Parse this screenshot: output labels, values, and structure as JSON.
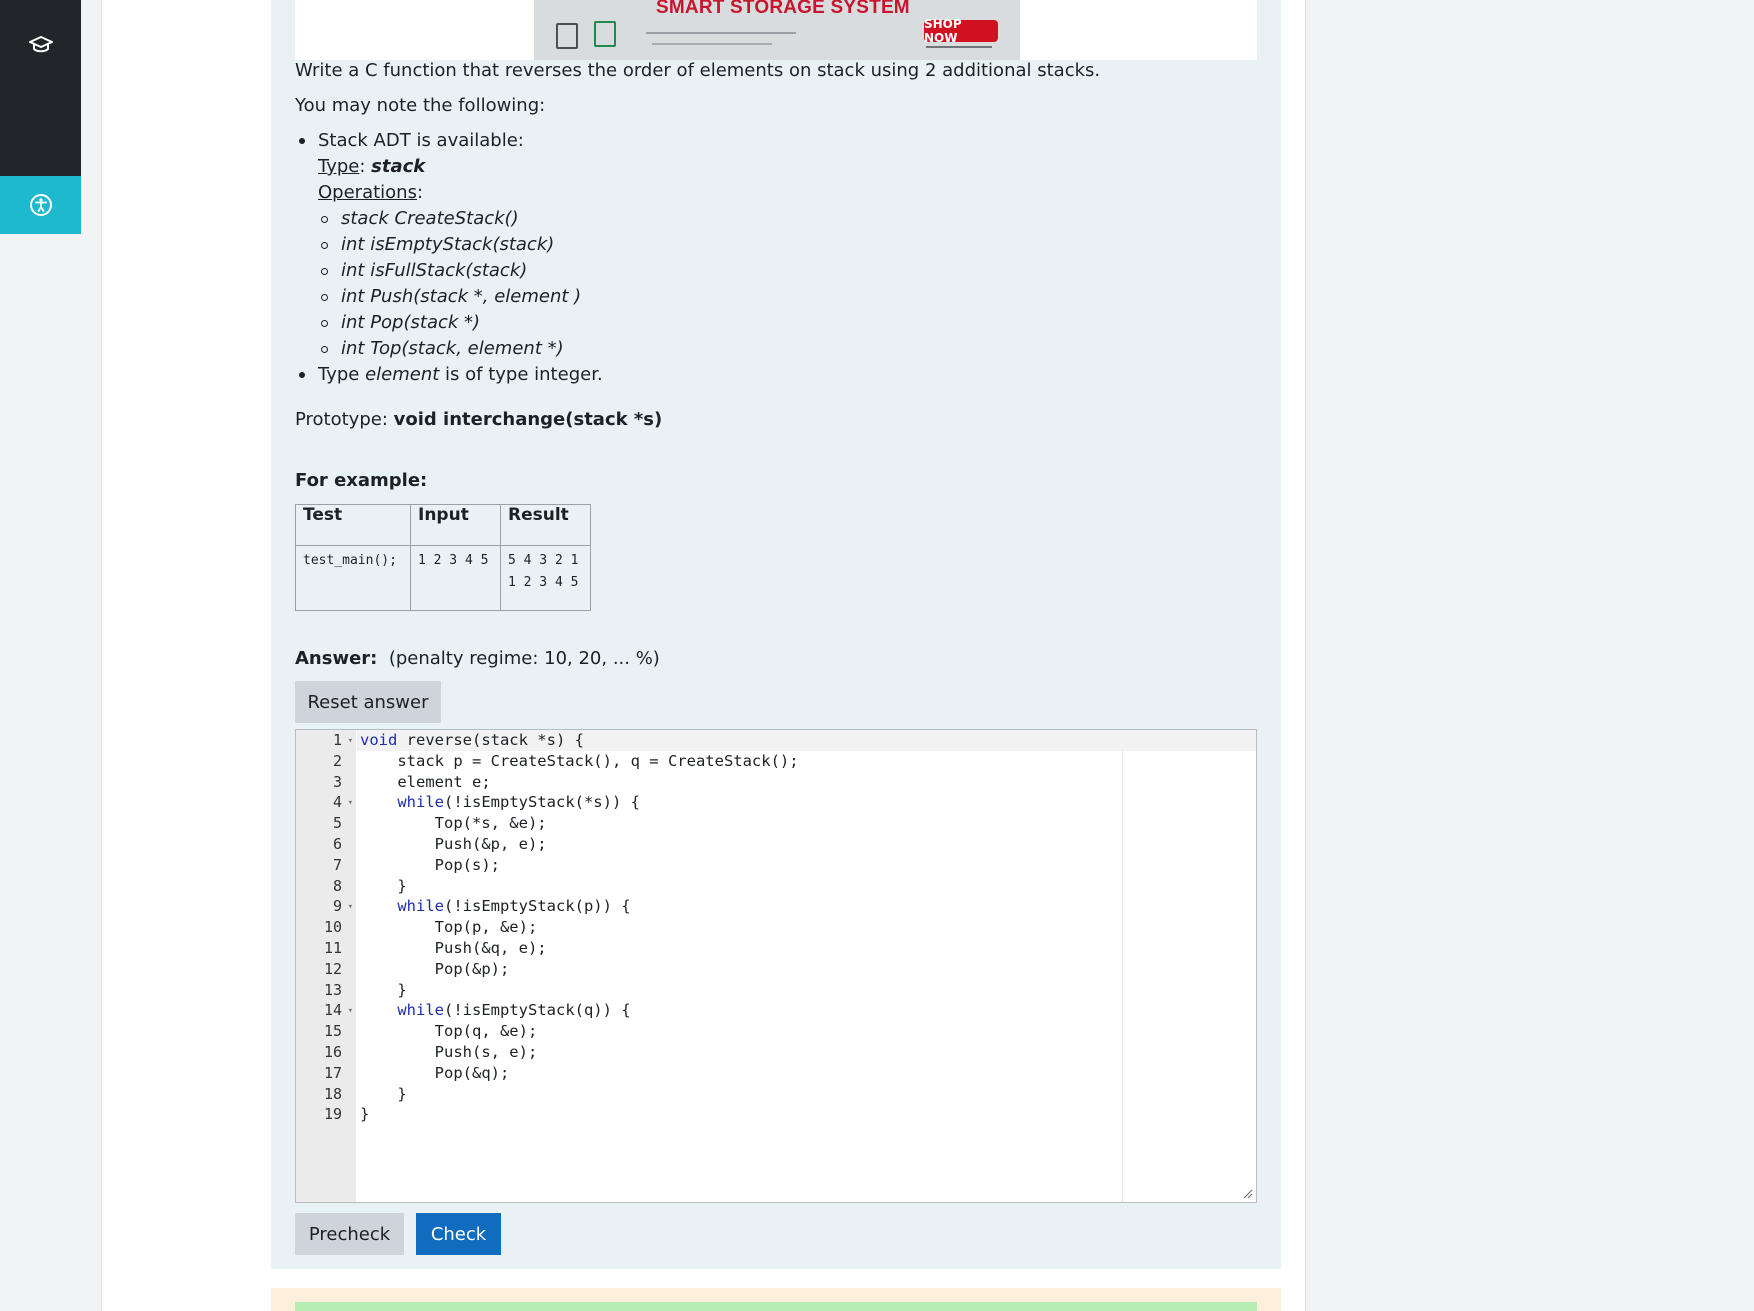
{
  "ad": {
    "title": "SMART STORAGE SYSTEM",
    "cta": "SHOP NOW"
  },
  "question": {
    "intro": "Write a C function that reverses the order of elements on stack using 2 additional stacks.",
    "note": "You may note the following:",
    "adt_label": "Stack ADT is available:",
    "type_key": "Type",
    "type_value": "stack",
    "ops_key": "Operations",
    "operations": [
      "stack CreateStack()",
      "int isEmptyStack(stack)",
      "int isFullStack(stack)",
      "int Push(stack *, element )",
      "int Pop(stack *)",
      "int Top(stack, element *)"
    ],
    "element_type_pre": "Type ",
    "element_type_em": "element",
    "element_type_post": " is of type integer.",
    "prototype_label": "Prototype: ",
    "prototype_value": "void interchange(stack *s)",
    "example_heading": "For example:",
    "table": {
      "headers": [
        "Test",
        "Input",
        "Result"
      ],
      "row": {
        "test": "test_main();",
        "input": "1 2 3 4 5",
        "result_lines": [
          "5 4 3 2 1",
          "1 2 3 4 5"
        ]
      }
    }
  },
  "answer": {
    "label": "Answer:",
    "penalty": "(penalty regime: 10, 20, ... %)",
    "reset_label": "Reset answer",
    "code_lines": [
      "void reverse(stack *s) {",
      "    stack p = CreateStack(), q = CreateStack();",
      "    element e;",
      "    while(!isEmptyStack(*s)) {",
      "        Top(*s, &e);",
      "        Push(&p, e);",
      "        Pop(s);",
      "    }",
      "    while(!isEmptyStack(p)) {",
      "        Top(p, &e);",
      "        Push(&q, e);",
      "        Pop(&p);",
      "    }",
      "    while(!isEmptyStack(q)) {",
      "        Top(q, &e);",
      "        Push(s, e);",
      "        Pop(&q);",
      "    }",
      "}"
    ],
    "fold_lines": [
      1,
      4,
      9,
      14
    ],
    "precheck_label": "Precheck",
    "check_label": "Check"
  },
  "icons": {
    "rail_courses": "graduation-cap-icon",
    "rail_accessibility": "accessibility-icon"
  },
  "colors": {
    "question_bg": "#e8f2f4",
    "check_button": "#0f6cbf",
    "accessibility_button": "#1fb9cf",
    "keyword": "#1e2cb0"
  }
}
